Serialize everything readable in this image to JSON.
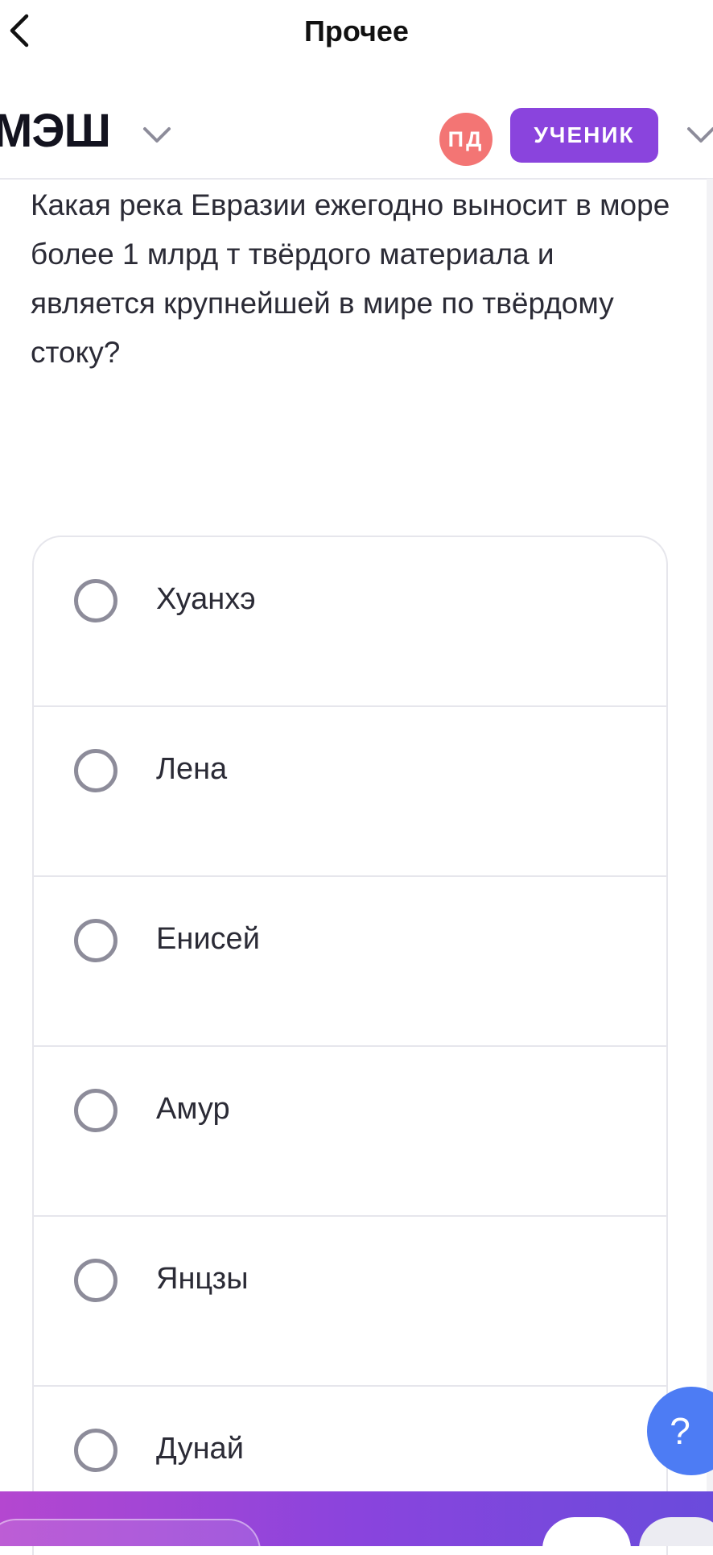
{
  "nav": {
    "title": "Прочее",
    "back_icon": "chevron-left-icon"
  },
  "header": {
    "logo": "МЭШ",
    "avatar_initials": "ПД",
    "role": "УЧЕНИК",
    "colors": {
      "avatar": "#f37574",
      "role_badge": "#8a44dd"
    }
  },
  "question": {
    "text": "Какая река Евразии ежегодно выносит в море более 1 млрд т твёрдого материала и является крупнейшей в мире по твёрдому стоку?"
  },
  "options": [
    {
      "label": "Хуанхэ",
      "selected": false
    },
    {
      "label": "Лена",
      "selected": false
    },
    {
      "label": "Енисей",
      "selected": false
    },
    {
      "label": "Амур",
      "selected": false
    },
    {
      "label": "Янцзы",
      "selected": false
    },
    {
      "label": "Дунай",
      "selected": false
    }
  ],
  "help": {
    "label": "?",
    "color": "#4d7cf4"
  },
  "bottom_bar": {
    "gradient": [
      "#b447d0",
      "#6a4bdc"
    ]
  }
}
